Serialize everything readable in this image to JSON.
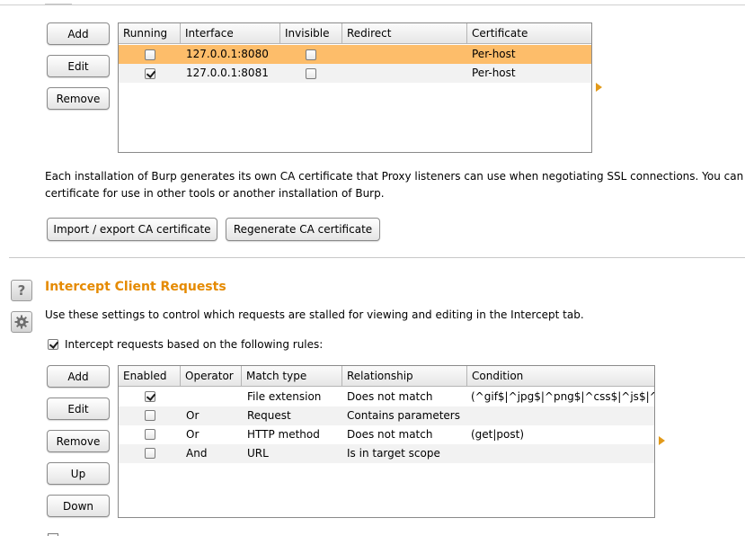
{
  "listeners": {
    "buttons": {
      "add": "Add",
      "edit": "Edit",
      "remove": "Remove"
    },
    "columns": [
      "Running",
      "Interface",
      "Invisible",
      "Redirect",
      "Certificate"
    ],
    "rows": [
      {
        "running": false,
        "interface": "127.0.0.1:8080",
        "invisible": false,
        "redirect": "",
        "certificate": "Per-host",
        "selected": true
      },
      {
        "running": true,
        "interface": "127.0.0.1:8081",
        "invisible": false,
        "redirect": "",
        "certificate": "Per-host",
        "selected": false
      }
    ]
  },
  "ca": {
    "description_line1": "Each installation of Burp generates its own CA certificate that Proxy listeners can use when negotiating SSL connections. You can imp",
    "description_line2": "certificate for use in other tools or another installation of Burp.",
    "import_export_label": "Import / export CA certificate",
    "regenerate_label": "Regenerate CA certificate"
  },
  "intercept": {
    "title": "Intercept Client Requests",
    "description": "Use these settings to control which requests are stalled for viewing and editing in the Intercept tab.",
    "checkbox_label": "Intercept requests based on the following rules:",
    "checkbox_checked": true,
    "buttons": {
      "add": "Add",
      "edit": "Edit",
      "remove": "Remove",
      "up": "Up",
      "down": "Down"
    },
    "columns": [
      "Enabled",
      "Operator",
      "Match type",
      "Relationship",
      "Condition"
    ],
    "rows": [
      {
        "enabled": true,
        "operator": "",
        "match_type": "File extension",
        "relationship": "Does not match",
        "condition": "(^gif$|^jpg$|^png$|^css$|^js$|^ico$)"
      },
      {
        "enabled": false,
        "operator": "Or",
        "match_type": "Request",
        "relationship": "Contains parameters",
        "condition": ""
      },
      {
        "enabled": false,
        "operator": "Or",
        "match_type": "HTTP method",
        "relationship": "Does not match",
        "condition": "(get|post)"
      },
      {
        "enabled": false,
        "operator": "And",
        "match_type": "URL",
        "relationship": "Is in target scope",
        "condition": ""
      }
    ]
  },
  "colors": {
    "accent_title": "#e58a00",
    "selected_row": "#fdbd6a",
    "alt_row": "#f2f2f2",
    "expand_arrow": "#e29a1a"
  },
  "icons": {
    "help": "help-icon",
    "settings": "gear-icon",
    "expand": "triangle-right-icon"
  }
}
